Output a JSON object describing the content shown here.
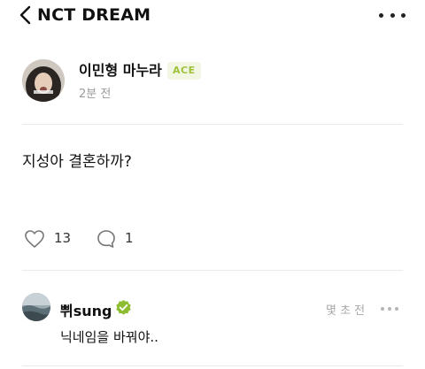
{
  "header": {
    "title": "NCT DREAM",
    "back_icon": "chevron-left-icon",
    "more_icon": "more-horizontal-icon"
  },
  "post": {
    "author": "이민형 마누라",
    "badge": "ACE",
    "badge_color": "#9fc23a",
    "time": "2분 전",
    "body": "지성아 결혼하까?",
    "likes": "13",
    "comments": "1"
  },
  "comment": {
    "author": "쀠sung",
    "verified_color": "#8dbd2f",
    "time": "몇 초 전",
    "body": "닉네임을 바꿔야.."
  }
}
